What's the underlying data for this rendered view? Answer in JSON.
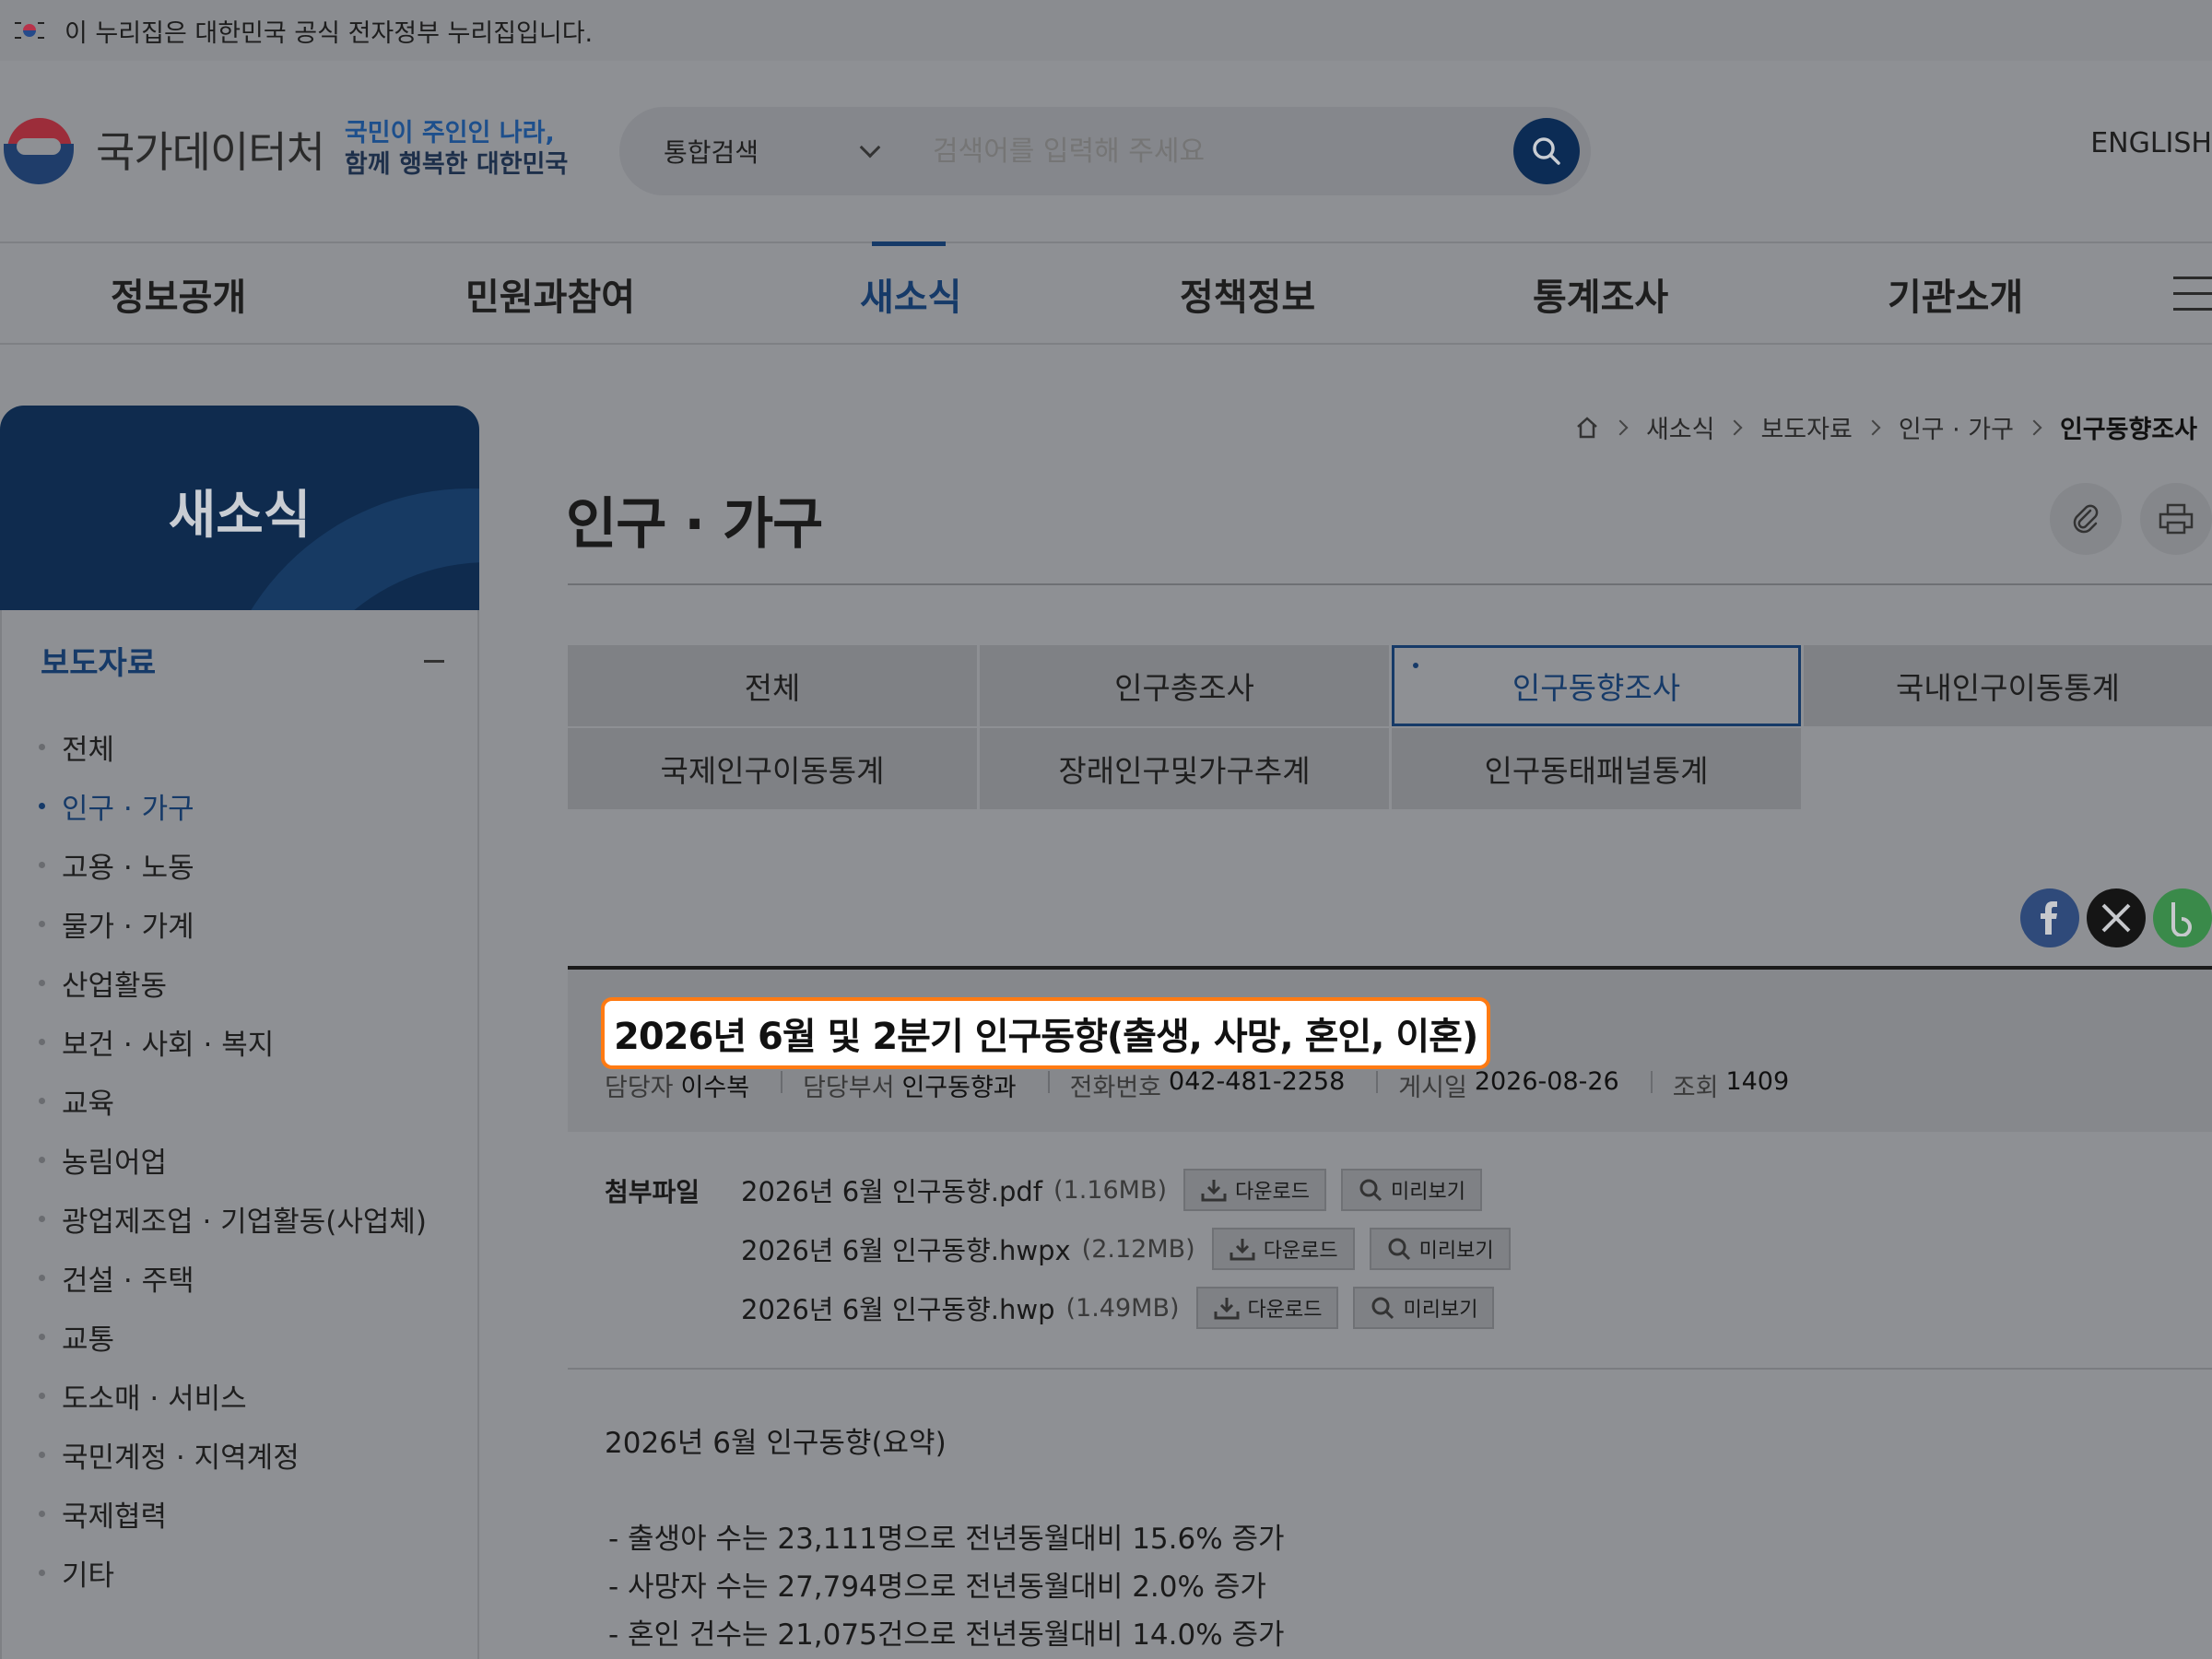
{
  "gov_banner": {
    "text": "이 누리집은 대한민국 공식 전자정부 누리집입니다."
  },
  "logo": {
    "name": "국가데이터처",
    "slogan_line1": "국민이 주인인 나라,",
    "slogan_line2": "함께 행복한 대한민국"
  },
  "search": {
    "scope": "통합검색",
    "placeholder": "검색어를 입력해 주세요"
  },
  "lang": "ENGLISH",
  "gnb": [
    "정보공개",
    "민원과참여",
    "새소식",
    "정책정보",
    "통계조사",
    "기관소개"
  ],
  "sidebar": {
    "title": "새소식",
    "section": "보도자료",
    "items": [
      "전체",
      "인구 · 가구",
      "고용 · 노동",
      "물가 · 가계",
      "산업활동",
      "보건 · 사회 · 복지",
      "교육",
      "농림어업",
      "광업제조업 · 기업활동(사업체)",
      "건설 · 주택",
      "교통",
      "도소매 · 서비스",
      "국민계정 · 지역계정",
      "국제협력",
      "기타"
    ],
    "active_index": 1
  },
  "breadcrumb": [
    "새소식",
    "보도자료",
    "인구 · 가구",
    "인구동향조사"
  ],
  "page_title": "인구 · 가구",
  "tabs": [
    "전체",
    "인구총조사",
    "인구동향조사",
    "국내인구이동통계",
    "국제인구이동통계",
    "장래인구및가구추계",
    "인구동태패널통계"
  ],
  "article": {
    "title": "2026년 6월 및 2분기 인구동향(출생, 사망, 혼인, 이혼)",
    "meta": {
      "author_label": "담당자",
      "author": "이수복",
      "dept_label": "담당부서",
      "dept": "인구동향과",
      "phone_label": "전화번호",
      "phone": "042-481-2258",
      "date_label": "게시일",
      "date": "2026-08-26",
      "views_label": "조회",
      "views": "1409"
    },
    "attach_label": "첨부파일",
    "files": [
      {
        "name": "2026년 6월 인구동향.pdf",
        "size": "(1.16MB)"
      },
      {
        "name": "2026년 6월 인구동향.hwpx",
        "size": "(2.12MB)"
      },
      {
        "name": "2026년 6월 인구동향.hwp",
        "size": "(1.49MB)"
      }
    ],
    "download_label": "다운로드",
    "preview_label": "미리보기",
    "summary_title": "2026년 6월 인구동향(요약)",
    "summary": [
      "- 출생아 수는 23,111명으로 전년동월대비 15.6% 증가",
      "- 사망자 수는 27,794명으로 전년동월대비 2.0% 증가",
      "- 혼인 건수는 21,075건으로 전년동월대비 14.0% 증가"
    ]
  },
  "colors": {
    "accent": "#163a68",
    "highlight": "#ff7a12",
    "overlay": "#8e9094"
  }
}
